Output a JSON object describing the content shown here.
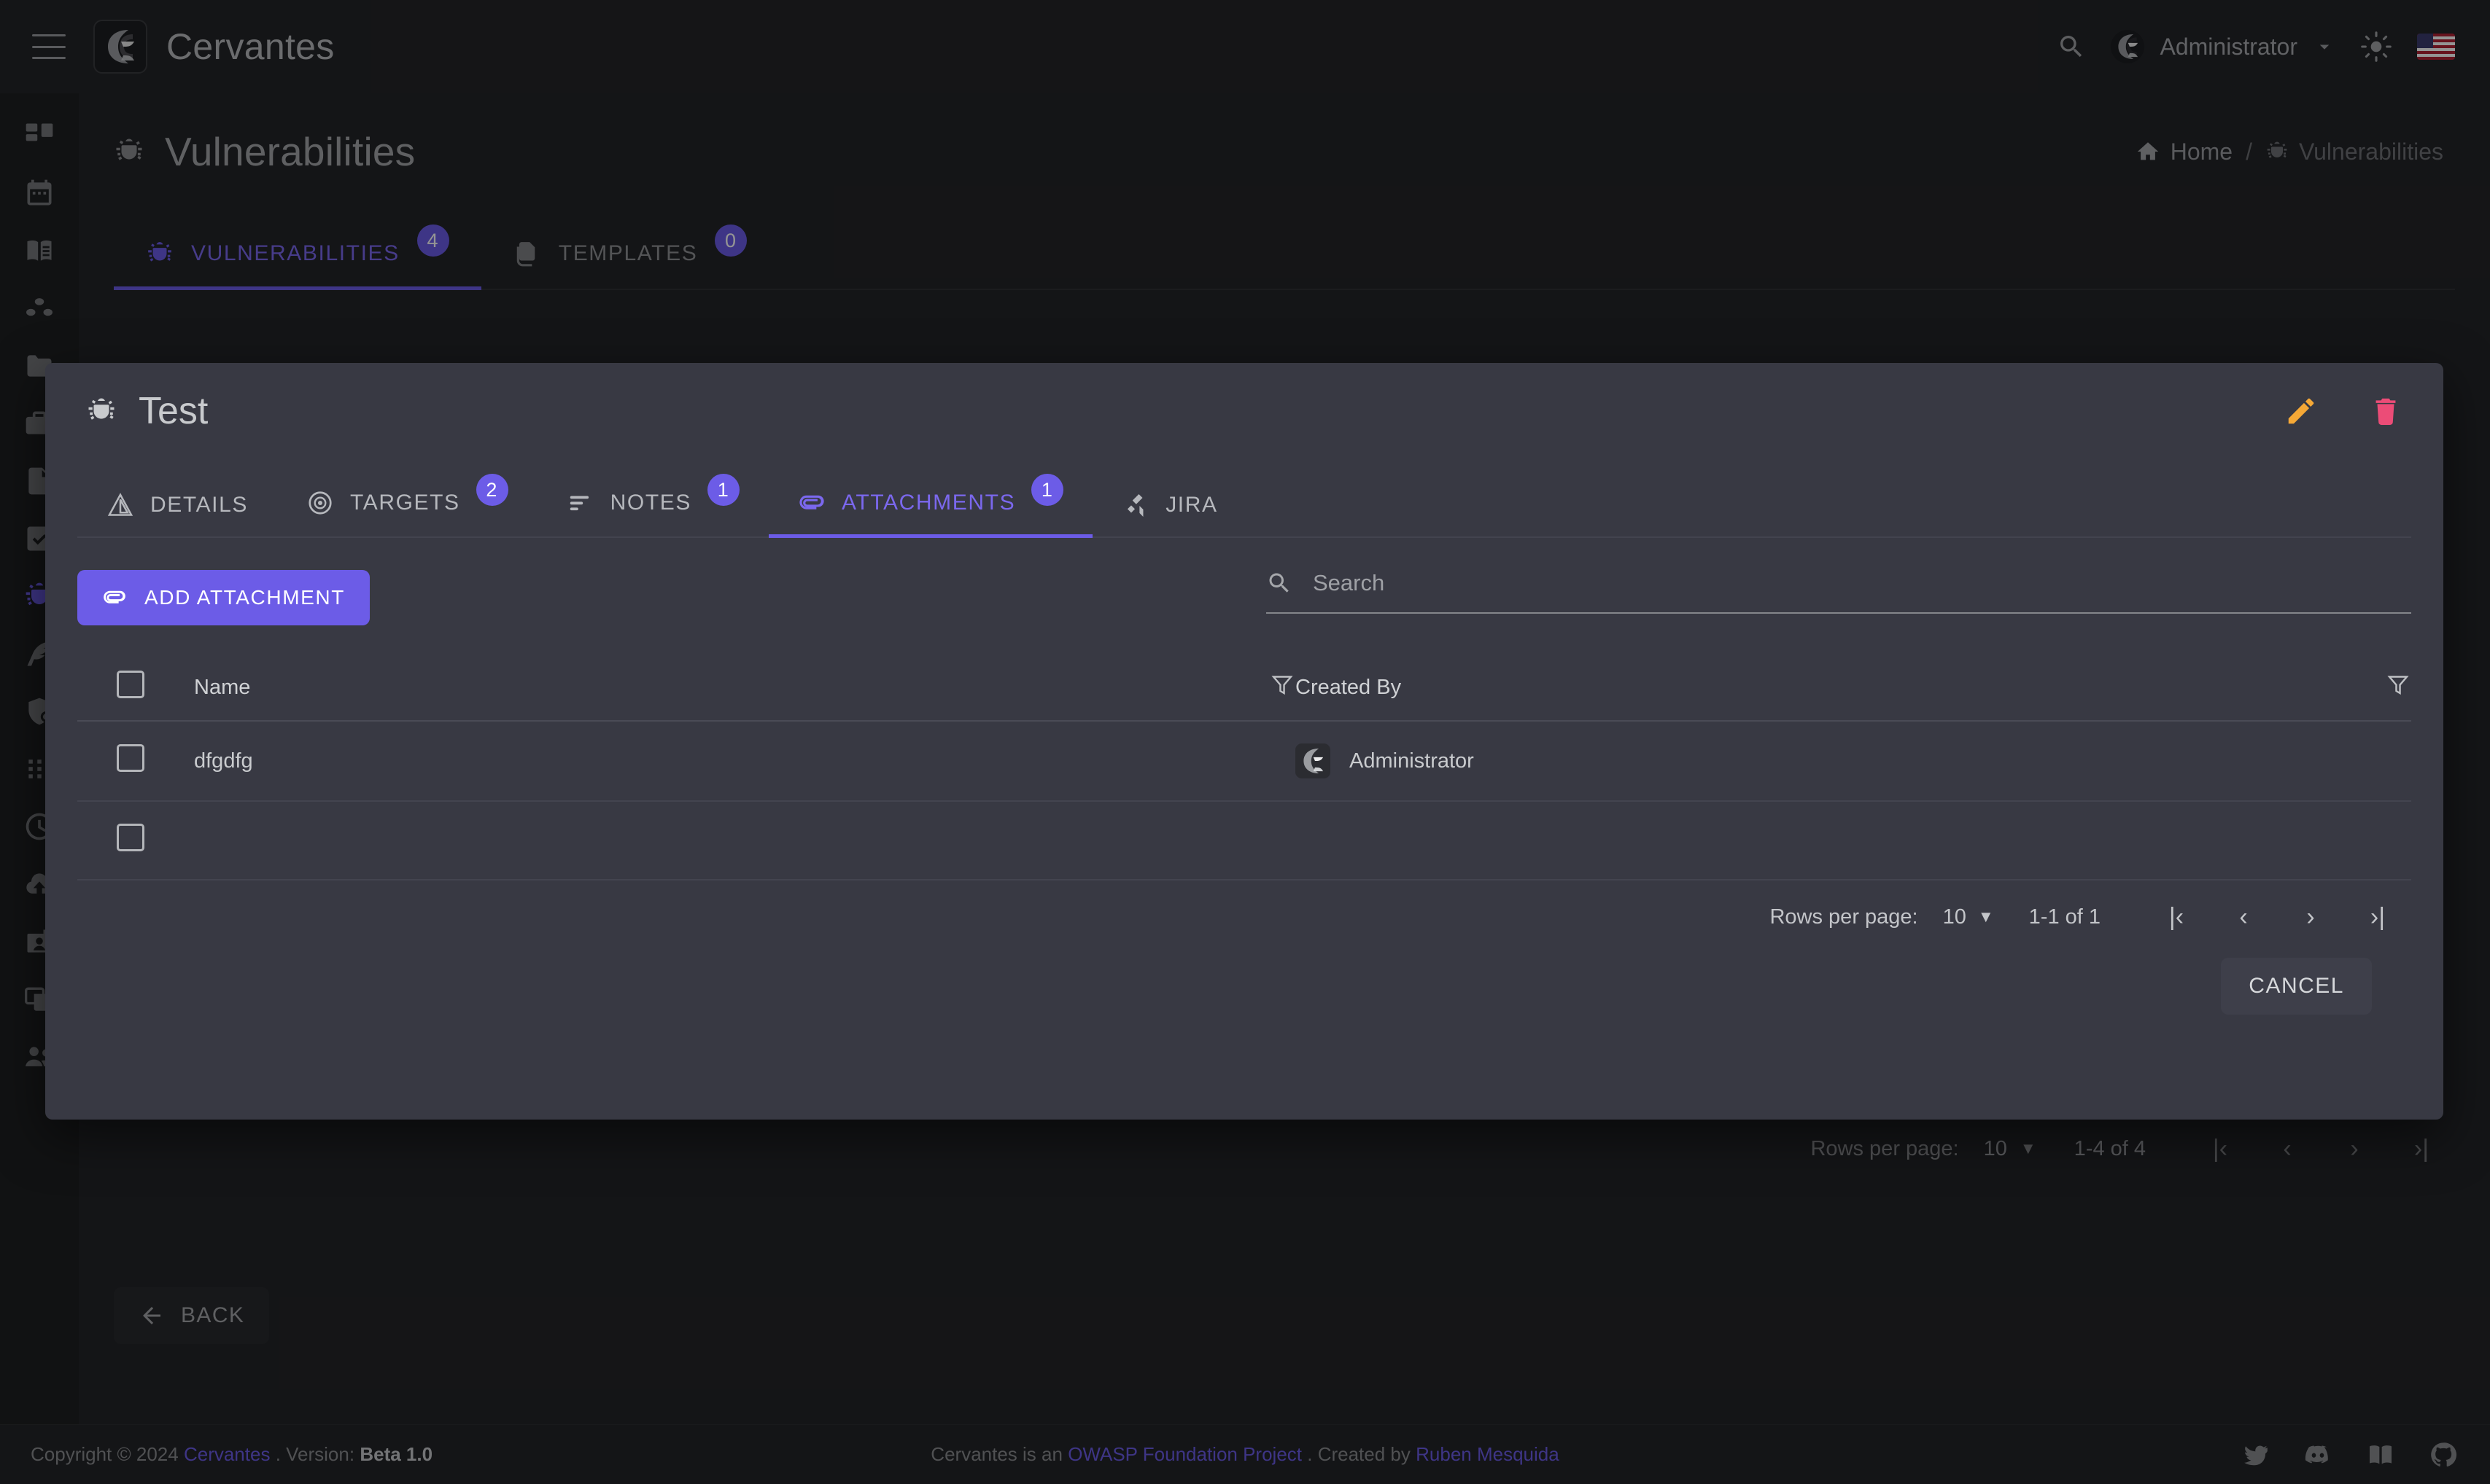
{
  "app": {
    "brand": "Cervantes",
    "brand_logo_icon": "cervantes-logo-icon",
    "accent": "#6c5ce7",
    "accent_light": "#7b68ee",
    "edit_color": "#f5a836",
    "delete_color": "#ec4c77"
  },
  "topbar": {
    "menu_icon": "hamburger-menu-icon",
    "search_icon": "search-icon",
    "user": "Administrator",
    "user_caret_icon": "chevron-down-icon",
    "theme_icon": "sun-icon",
    "language_flag": "us-flag-icon"
  },
  "sidebar": {
    "items": [
      {
        "name": "dashboard",
        "icon": "dashboard-grid-icon",
        "active": false
      },
      {
        "name": "calendar",
        "icon": "calendar-icon",
        "active": false
      },
      {
        "name": "knowledge-base",
        "icon": "book-icon",
        "active": false
      },
      {
        "name": "organizations",
        "icon": "organization-icon",
        "active": false
      },
      {
        "name": "projects",
        "icon": "folder-icon",
        "active": false
      },
      {
        "name": "clients",
        "icon": "briefcase-icon",
        "active": false
      },
      {
        "name": "reports",
        "icon": "document-icon",
        "active": false
      },
      {
        "name": "checklists",
        "icon": "document-check-icon",
        "active": false
      },
      {
        "name": "vulnerabilities",
        "icon": "bug-icon",
        "active": true
      },
      {
        "name": "templates",
        "icon": "feather-icon",
        "active": false
      },
      {
        "name": "shield",
        "icon": "shield-search-icon",
        "active": false
      },
      {
        "name": "apps",
        "icon": "dots-grid-icon",
        "active": false
      },
      {
        "name": "history",
        "icon": "clock-icon",
        "active": false
      },
      {
        "name": "imports",
        "icon": "cloud-upload-icon",
        "active": false
      },
      {
        "name": "profile",
        "icon": "id-card-icon",
        "active": false
      },
      {
        "name": "windows",
        "icon": "windows-icon",
        "active": false
      },
      {
        "name": "users",
        "icon": "users-icon",
        "active": false
      }
    ]
  },
  "page": {
    "title": "Vulnerabilities",
    "title_icon": "bug-icon",
    "breadcrumb": {
      "home": "Home",
      "home_icon": "home-icon",
      "separator": "/",
      "current": "Vulnerabilities",
      "current_icon": "bug-icon"
    },
    "tabs": [
      {
        "label": "VULNERABILITIES",
        "badge": "4",
        "icon": "bug-icon",
        "active": true
      },
      {
        "label": "TEMPLATES",
        "badge": "0",
        "icon": "copy-document-icon",
        "active": false
      }
    ],
    "background_pagination": {
      "rows_per_page_label": "Rows per page:",
      "rows_per_page_value": "10",
      "caret_icon": "caret-down-icon",
      "range": "1-4 of 4",
      "first_icon": "first-page-icon",
      "prev_icon": "prev-page-icon",
      "next_icon": "next-page-icon",
      "last_icon": "last-page-icon"
    },
    "back_button": {
      "label": "BACK",
      "icon": "arrow-left-icon"
    }
  },
  "dialog": {
    "title": "Test",
    "title_icon": "bug-icon",
    "edit_icon": "pencil-edit-icon",
    "delete_icon": "trash-delete-icon",
    "tabs": [
      {
        "label": "DETAILS",
        "icon": "warning-triangle-icon",
        "badge": null,
        "active": false
      },
      {
        "label": "TARGETS",
        "icon": "target-icon",
        "badge": "2",
        "active": false
      },
      {
        "label": "NOTES",
        "icon": "notes-lines-icon",
        "badge": "1",
        "active": false
      },
      {
        "label": "ATTACHMENTS",
        "icon": "paperclip-icon",
        "badge": "1",
        "active": true
      },
      {
        "label": "JIRA",
        "icon": "jira-icon",
        "badge": null,
        "active": false
      }
    ],
    "add_attachment_button": {
      "label": "ADD ATTACHMENT",
      "icon": "paperclip-icon"
    },
    "search": {
      "placeholder": "Search",
      "value": "",
      "icon": "search-icon"
    },
    "table": {
      "select_all_checkbox_icon": "checkbox-unchecked-icon",
      "columns": [
        {
          "label": "Name",
          "filter_icon": "filter-funnel-icon"
        },
        {
          "label": "Created By",
          "filter_icon": "filter-funnel-icon"
        }
      ],
      "rows": [
        {
          "checkbox_icon": "checkbox-unchecked-icon",
          "name": "dfgdfg",
          "created_by": "Administrator",
          "avatar_icon": "cervantes-avatar-icon"
        },
        {
          "checkbox_icon": "checkbox-unchecked-icon",
          "name": "",
          "created_by": "",
          "avatar_icon": ""
        }
      ]
    },
    "pagination": {
      "rows_per_page_label": "Rows per page:",
      "rows_per_page_value": "10",
      "caret_icon": "caret-down-icon",
      "range": "1-1 of 1",
      "first_icon": "first-page-icon",
      "prev_icon": "prev-page-icon",
      "next_icon": "next-page-icon",
      "last_icon": "last-page-icon"
    },
    "cancel_button": "CANCEL"
  },
  "footer": {
    "copyright_prefix": "Copyright © 2024",
    "copyright_brand": "Cervantes",
    "version_label": ". Version:",
    "version_value": "Beta 1.0",
    "center_prefix": "Cervantes is an",
    "center_link": "OWASP Foundation Project",
    "center_mid": ". Created by",
    "center_author": "Ruben Mesquida",
    "icons": [
      "twitter-icon",
      "discord-icon",
      "docs-book-icon",
      "github-icon"
    ]
  }
}
